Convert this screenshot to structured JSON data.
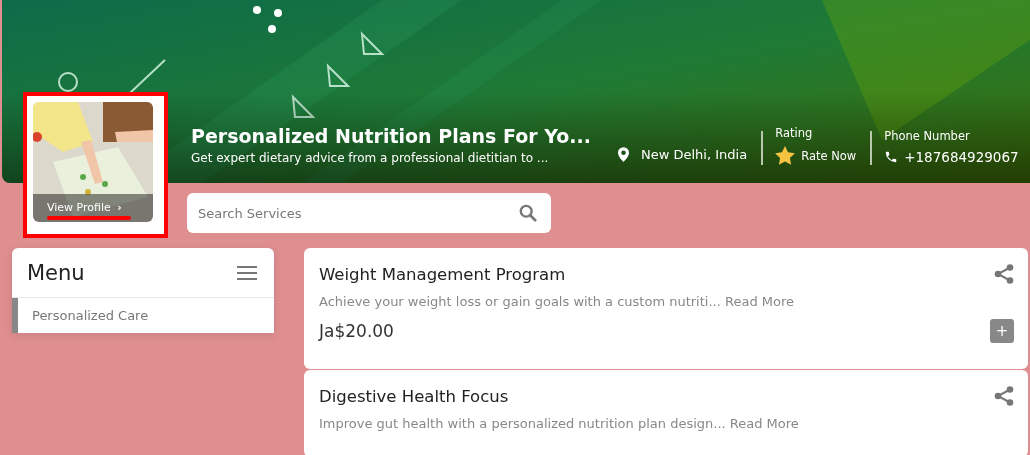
{
  "profile": {
    "link": "View Profile",
    "chevron": "›"
  },
  "header": {
    "title": "Personalized Nutrition Plans For Yo...",
    "subtitle": "Get expert dietary advice from a professional dietitian to ...",
    "location": "New Delhi, India",
    "rating_label": "Rating",
    "rating_action": "Rate Now",
    "phone_label": "Phone Number",
    "phone": "+187684929067"
  },
  "search": {
    "placeholder": "Search Services"
  },
  "menu": {
    "title": "Menu",
    "items": [
      {
        "label": "Personalized Care",
        "selected": true
      }
    ]
  },
  "services": [
    {
      "title": "Weight Management Program",
      "description": "Achieve your weight loss or gain goals with a custom nutriti...",
      "link": "Read More",
      "price": "Ja$20.00",
      "add": "+"
    },
    {
      "title": "Digestive Health Focus",
      "description": "Improve gut health with a personalized nutrition plan design...",
      "link": "Read More"
    }
  ]
}
